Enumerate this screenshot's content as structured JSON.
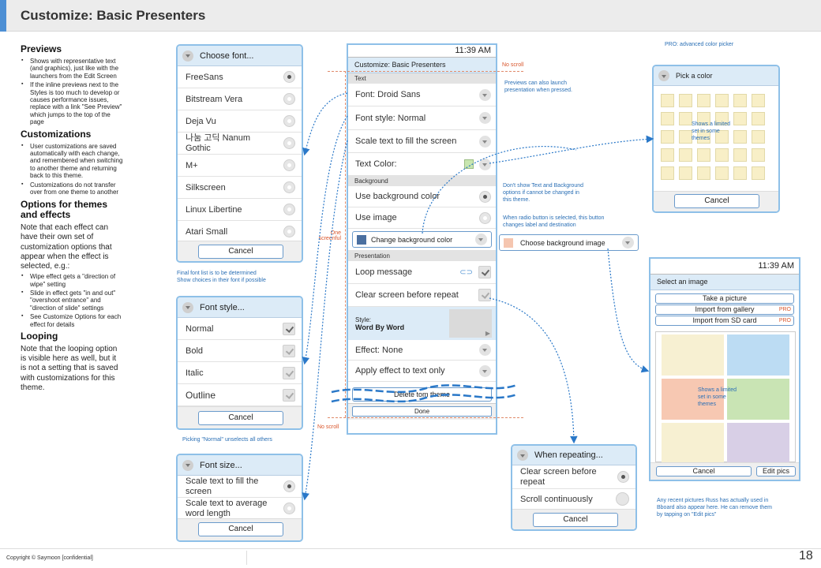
{
  "page": {
    "title": "Customize: Basic Presenters",
    "footer": "Copyright © Saymoon [confidential]",
    "page_number": "18"
  },
  "notes": {
    "previews_heading": "Previews",
    "previews_items": [
      "Shows with representative text (and graphics), just like with the launchers from the Edit Screen",
      "If the inline previews next to the Styles is too much to develop or causes performance issues, replace with a link \"See Preview\" which jumps to the top of the page"
    ],
    "custom_heading": "Customizations",
    "custom_items": [
      "User customizations are saved automatically with each change, and remembered when switching to another theme and returning back to this theme.",
      "Customizations do not transfer over from one theme to another"
    ],
    "options_heading": "Options for themes and effects",
    "options_para": "Note that each effect can have their own set of customization options that appear when the effect is selected, e.g.:",
    "options_items": [
      "Wipe effect gets a \"direction of wipe\" setting",
      "Slide in effect gets \"in and out\" \"overshoot entrance\" and \"direction of slide\" settings",
      "See Customize Options for each effect for details"
    ],
    "looping_heading": "Looping",
    "looping_para": "Note that the looping option is visible here as well, but it is not a setting that is saved with customizations for this theme."
  },
  "font_dialog": {
    "title": "Choose font...",
    "options": [
      "FreeSans",
      "Bitstream Vera",
      "Deja Vu",
      "나눔 고딕 Nanum Gothic",
      "M+",
      "Silkscreen",
      "Linux Libertine",
      "Atari Small"
    ],
    "cancel": "Cancel",
    "note": "Final font list is to be determined\nShow choices in their font if possible"
  },
  "style_dialog": {
    "title": "Font style...",
    "options": [
      "Normal",
      "Bold",
      "Italic",
      "Outline"
    ],
    "cancel": "Cancel",
    "note": "Picking \"Normal\" unselects all others"
  },
  "size_dialog": {
    "title": "Font size...",
    "options": [
      "Scale text to fill the screen",
      "Scale text to average word length"
    ],
    "cancel": "Cancel"
  },
  "phone": {
    "time": "11:39 AM",
    "title": "Customize:  Basic Presenters",
    "text_section": "Text",
    "font": "Font: Droid Sans",
    "font_style": "Font style: Normal",
    "scale": "Scale text to fill  the screen",
    "text_color": "Text Color:",
    "text_color_value": "#c8e6b0",
    "bg_section": "Background",
    "use_bg_color": "Use background color",
    "use_image": "Use image",
    "change_bg_color": "Change background color",
    "bg_color_value": "#4a6fa0",
    "pres_section": "Presentation",
    "loop": "Loop message",
    "clear": "Clear screen before repeat",
    "style_label": "Style:",
    "style_value": "Word By Word",
    "effect": "Effect: None",
    "apply_effect": "Apply effect to text only",
    "delete": "Delete       tom theme",
    "done": "Done"
  },
  "alt_button": {
    "label": "Choose background image",
    "swatch": "#f5c6b0"
  },
  "annotations": {
    "no_scroll_top": "No scroll",
    "no_scroll_bottom": "No scroll",
    "one_screenful": "One\nscreenful",
    "previews_launch": "Previews can also launch\npresentation when pressed.",
    "dont_show": "Don't show Text and Background\noptions if cannot be changed in\nthis theme.",
    "radio_note": "When radio button is selected, this button\nchanges label and destination",
    "pro_picker": "PRO: advanced color picker",
    "limited_set": "Shows a limited\nset in some\nthemes",
    "limited_set_2": "Shows a limited\nset in some\nthemes",
    "recent_pics": "Any recent pictures Russ has actually used in\nBboard also appear here. He can remove them\nby tapping on \"Edit pics\""
  },
  "color_dialog": {
    "title": "Pick a color",
    "cancel": "Cancel"
  },
  "image_phone": {
    "time": "11:39 AM",
    "title": "Select an image",
    "take": "Take a picture",
    "gallery": "Import from gallery",
    "sd": "Import from SD card",
    "pro": "PRO",
    "cancel": "Cancel",
    "edit": "Edit pics",
    "tiles": [
      "#f7f0d2",
      "#bcdcf3",
      "#f7c8b2",
      "#c9e4b4",
      "#f7f0d2",
      "#d8cfe6"
    ]
  },
  "repeat_dialog": {
    "title": "When repeating...",
    "options": [
      "Clear screen before repeat",
      "Scroll continuously"
    ],
    "cancel": "Cancel"
  }
}
